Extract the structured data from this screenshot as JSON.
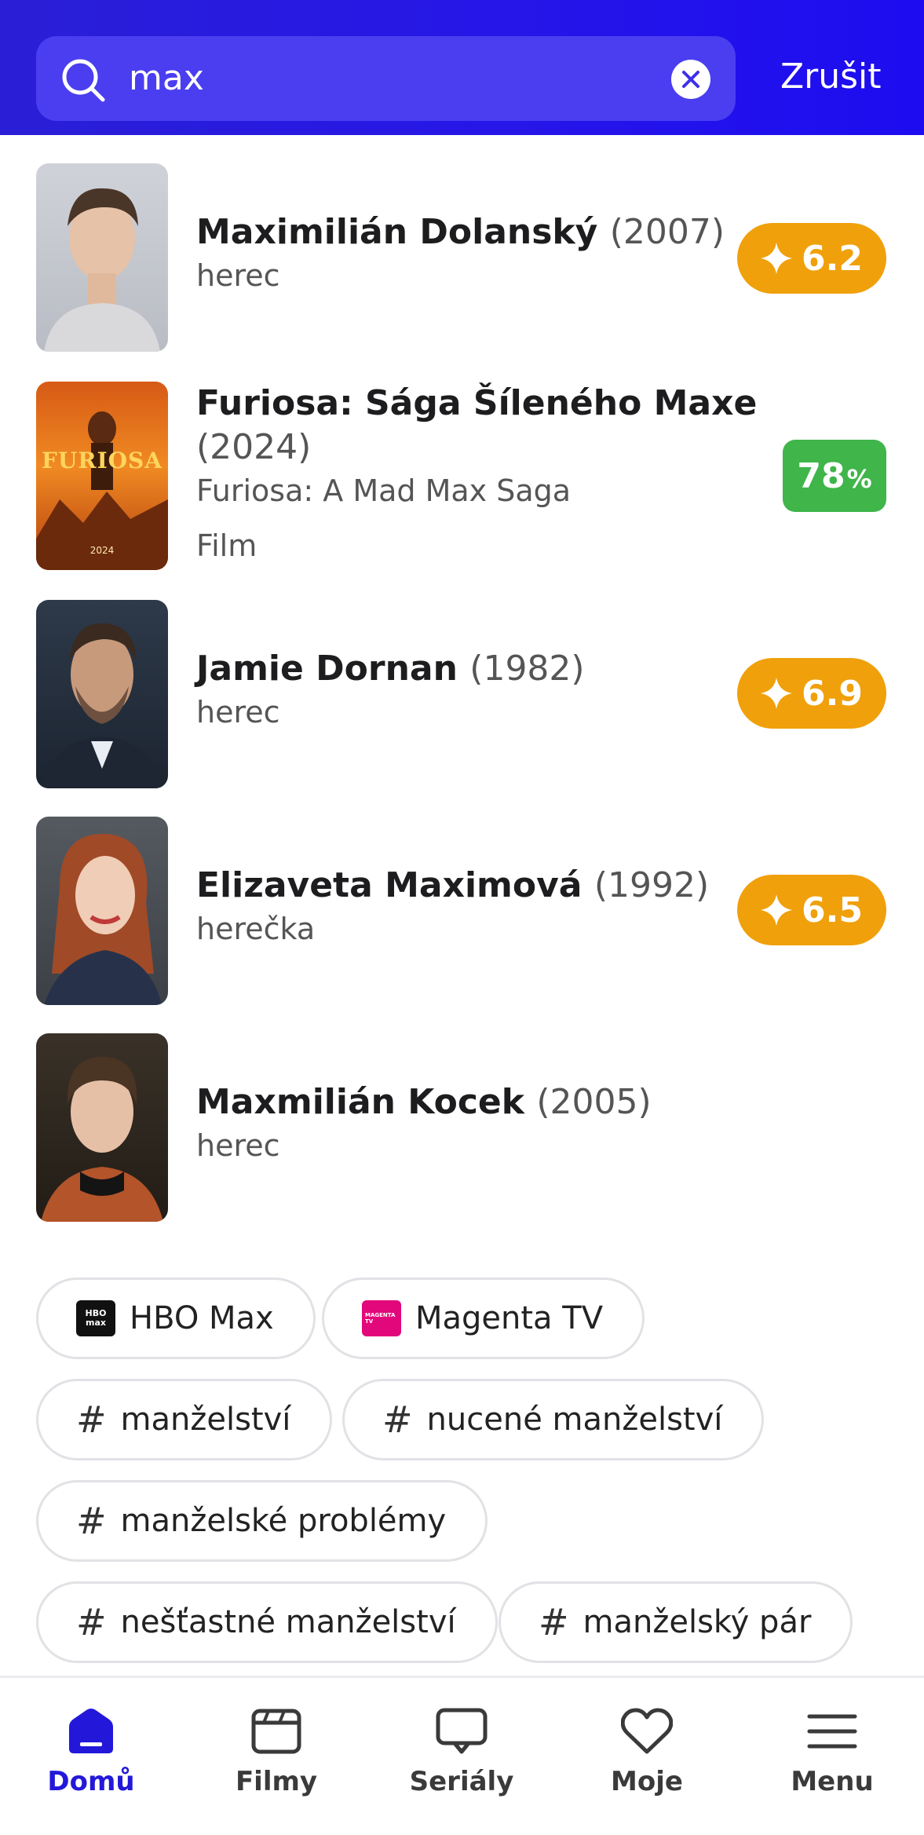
{
  "search": {
    "value": "max",
    "cancel_label": "Zrušit"
  },
  "results": [
    {
      "name": "Maximilián Dolanský",
      "year": "(2007)",
      "role": "herec",
      "rating": "6.2",
      "rating_color": "#f0a00b"
    },
    {
      "name": "Furiosa: Sága Šíleného Maxe",
      "year": "(2024)",
      "original_title": "Furiosa: A Mad Max Saga",
      "type": "Film",
      "score": "78",
      "score_unit": "%",
      "score_color": "#3fb54a"
    },
    {
      "name": "Jamie Dornan",
      "year": "(1982)",
      "role": "herec",
      "rating": "6.9",
      "rating_color": "#f0a00b"
    },
    {
      "name": "Elizaveta Maximová",
      "year": "(1992)",
      "role": "herečka",
      "rating": "6.5",
      "rating_color": "#f0a00b"
    },
    {
      "name": "Maxmilián Kocek",
      "year": "(2005)",
      "role": "herec"
    }
  ],
  "poster": {
    "title": "FURIOSA",
    "year": "2024"
  },
  "chips": {
    "platforms": [
      {
        "label": "HBO Max",
        "logo": "hbo-max-logo"
      },
      {
        "label": "Magenta TV",
        "logo": "magenta-tv-logo"
      }
    ],
    "tags": [
      "manželství",
      "nucené manželství",
      "manželské problémy",
      "nešťastné manželství",
      "manželský pár"
    ],
    "hash": "#"
  },
  "nav": [
    {
      "label": "Domů",
      "icon": "home-icon",
      "active": true
    },
    {
      "label": "Filmy",
      "icon": "film-icon"
    },
    {
      "label": "Seriály",
      "icon": "tv-icon"
    },
    {
      "label": "Moje",
      "icon": "heart-icon"
    },
    {
      "label": "Menu",
      "icon": "menu-icon"
    }
  ],
  "colors": {
    "header": "#2a1fd6",
    "accent": "#2318d9",
    "star_badge": "#f0a00b",
    "score_badge": "#3fb54a"
  }
}
